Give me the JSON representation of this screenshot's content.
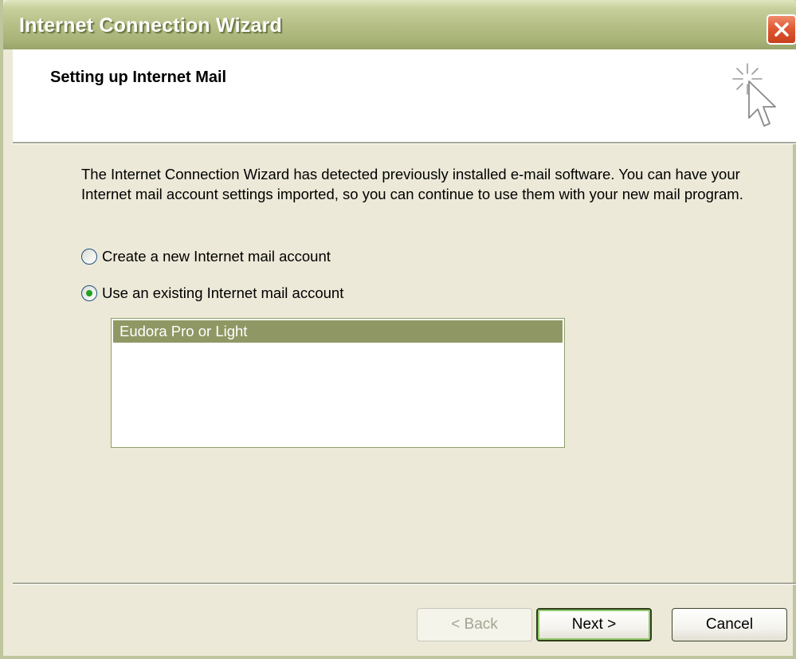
{
  "window": {
    "title": "Internet Connection Wizard"
  },
  "header": {
    "title": "Setting up Internet Mail"
  },
  "body": {
    "description": "The Internet Connection Wizard has detected previously installed e-mail software. You can have your Internet mail account settings imported, so you can continue to use them with your new mail program.",
    "options": [
      {
        "label": "Create a new Internet mail account",
        "checked": false
      },
      {
        "label": "Use an existing Internet mail account",
        "checked": true
      }
    ],
    "accounts": [
      {
        "label": "Eudora Pro or Light",
        "selected": true
      }
    ]
  },
  "buttons": {
    "back": "< Back",
    "next": "Next >",
    "cancel": "Cancel"
  },
  "colors": {
    "titlebar": "#b3bd84",
    "selection": "#8f9864",
    "close": "#e05a34"
  }
}
